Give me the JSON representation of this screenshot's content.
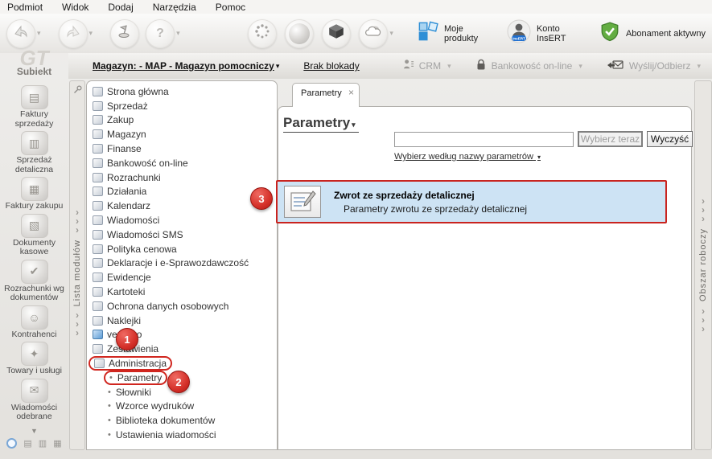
{
  "menubar": {
    "items": [
      "Podmiot",
      "Widok",
      "Dodaj",
      "Narzędzia",
      "Pomoc"
    ]
  },
  "toolbar": {
    "products_label": "Moje produkty",
    "account_label": "Konto InsERT",
    "account_badge": "InsERT",
    "subscription_label": "Abonament aktywny"
  },
  "ribbon": {
    "warehouse": "Magazyn: - MAP - Magazyn pomocniczy",
    "lock_status": "Brak blokady",
    "crm": "CRM",
    "banking": "Bankowość on-line",
    "send_receive": "Wyślij/Odbierz"
  },
  "sidebar": {
    "app_logo": "GT",
    "app_name": "Subiekt",
    "modules": [
      {
        "label": "Faktury sprzedaży",
        "icon": "sales-invoices",
        "glyph": "▤"
      },
      {
        "label": "Sprzedaż detaliczna",
        "icon": "retail-sales",
        "glyph": "▥"
      },
      {
        "label": "Faktury zakupu",
        "icon": "purchase-invoices",
        "glyph": "▦"
      },
      {
        "label": "Dokumenty kasowe",
        "icon": "cash-documents",
        "glyph": "▧"
      },
      {
        "label": "Rozrachunki wg dokumentów",
        "icon": "settlements",
        "glyph": "✔"
      },
      {
        "label": "Kontrahenci",
        "icon": "contractors",
        "glyph": "☺"
      },
      {
        "label": "Towary i usługi",
        "icon": "goods-services",
        "glyph": "✦"
      },
      {
        "label": "Wiadomości odebrane",
        "icon": "inbox-messages",
        "glyph": "✉"
      }
    ]
  },
  "left_strip": {
    "label": "Lista modułów"
  },
  "right_strip": {
    "label": "Obszar roboczy"
  },
  "tree": {
    "items": [
      {
        "label": "Strona główna"
      },
      {
        "label": "Sprzedaż"
      },
      {
        "label": "Zakup"
      },
      {
        "label": "Magazyn"
      },
      {
        "label": "Finanse"
      },
      {
        "label": "Bankowość on-line"
      },
      {
        "label": "Rozrachunki"
      },
      {
        "label": "Działania"
      },
      {
        "label": "Kalendarz"
      },
      {
        "label": "Wiadomości"
      },
      {
        "label": "Wiadomości SMS"
      },
      {
        "label": "Polityka cenowa"
      },
      {
        "label": "Deklaracje i e-Sprawozdawczość"
      },
      {
        "label": "Ewidencje"
      },
      {
        "label": "Kartoteki"
      },
      {
        "label": "Ochrona danych osobowych"
      },
      {
        "label": "Naklejki"
      },
      {
        "label": "vendero"
      },
      {
        "label": "Zestawienia"
      },
      {
        "label": "Administracja",
        "highlighted": true
      },
      {
        "label": "Parametry",
        "bullet": true,
        "highlighted": true
      },
      {
        "label": "Słowniki",
        "bullet": true
      },
      {
        "label": "Wzorce wydruków",
        "bullet": true
      },
      {
        "label": "Biblioteka dokumentów",
        "bullet": true
      },
      {
        "label": "Ustawienia wiadomości",
        "bullet": true
      }
    ]
  },
  "main": {
    "tab": "Parametry",
    "title": "Parametry",
    "search_value": "",
    "select_button": "Wybierz teraz",
    "clear_button": "Wyczyść",
    "filter_link": "Wybierz według nazwy parametrów",
    "result": {
      "title": "Zwrot ze sprzedaży detalicznej",
      "subtitle": "Parametry zwrotu ze sprzedaży detalicznej"
    }
  },
  "annotations": {
    "step1": "1",
    "step2": "2",
    "step3": "3"
  },
  "icons": {
    "caret": "▾",
    "caret_down": "▼",
    "chevron": "›",
    "close": "×",
    "bullet": "•",
    "help": "?"
  },
  "colors": {
    "annotation_red": "#d5312a",
    "selection_bg": "#cde3f4",
    "selection_border": "#c9241f",
    "disabled_text": "#a3a3a3",
    "subscription_green": "#57a63a",
    "products_blue": "#2f8fd6"
  }
}
